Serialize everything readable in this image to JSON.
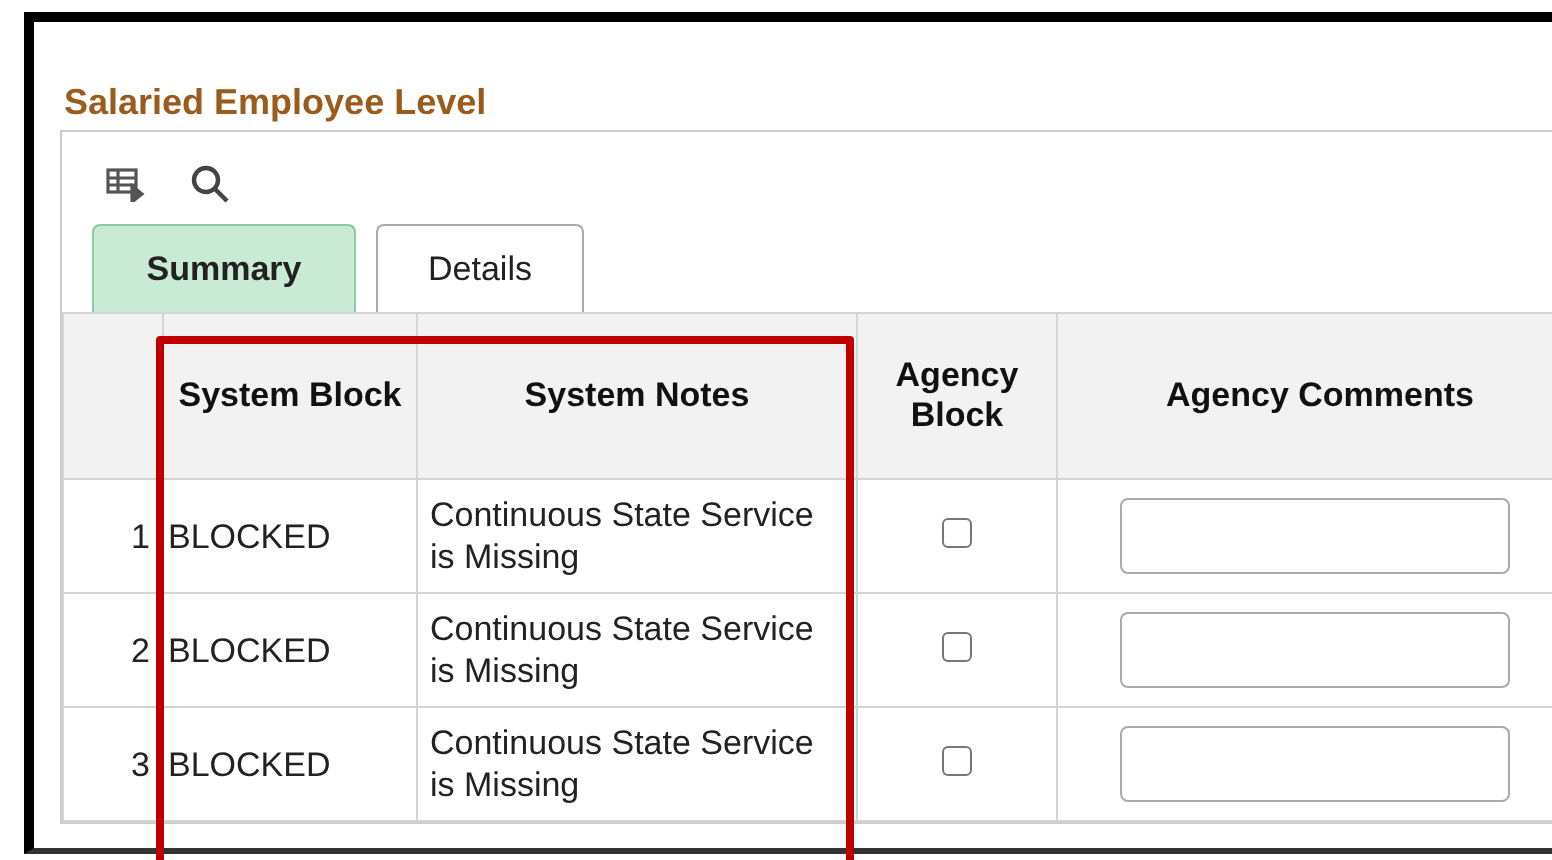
{
  "section_title": "Salaried Employee Level",
  "tabs": [
    {
      "label": "Summary",
      "selected": true
    },
    {
      "label": "Details",
      "selected": false
    }
  ],
  "table": {
    "columns": [
      "",
      "System Block",
      "System Notes",
      "Agency Block",
      "Agency Comments"
    ],
    "rows": [
      {
        "number": "1",
        "system_block": "BLOCKED",
        "system_notes": "Continuous State Service is Missing",
        "agency_block": false
      },
      {
        "number": "2",
        "system_block": "BLOCKED",
        "system_notes": "Continuous State Service is Missing",
        "agency_block": false
      },
      {
        "number": "3",
        "system_block": "BLOCKED",
        "system_notes": "Continuous State Service is Missing",
        "agency_block": false
      }
    ]
  }
}
